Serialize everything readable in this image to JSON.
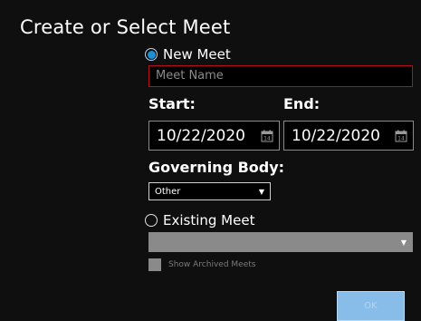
{
  "dialog": {
    "title": "Create or Select Meet"
  },
  "new_meet": {
    "label": "New Meet",
    "selected": true,
    "name_placeholder": "Meet Name",
    "start_label": "Start:",
    "end_label": "End:",
    "start_date": "10/22/2020",
    "end_date": "10/22/2020",
    "governing_body_label": "Governing Body:",
    "governing_body_value": "Other"
  },
  "existing_meet": {
    "label": "Existing Meet",
    "selected": false,
    "show_archived_label": "Show Archived Meets"
  },
  "buttons": {
    "ok_label": "OK"
  },
  "icons": {
    "calendar": "calendar-icon",
    "dropdown": "chevron-down-icon"
  },
  "colors": {
    "background": "#0f0f0f",
    "radio_selected": "#1e8fd6",
    "input_error_border": "#b3101a",
    "ok_button": "#87bde8",
    "disabled_control": "#8a8a8a"
  }
}
